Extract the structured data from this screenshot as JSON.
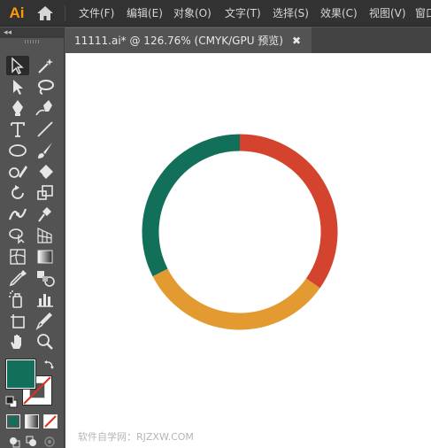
{
  "app": {
    "logo": "Ai",
    "home_icon": "home-icon"
  },
  "menu": {
    "items": [
      "文件(F)",
      "编辑(E)",
      "对象(O)",
      "文字(T)",
      "选择(S)",
      "效果(C)",
      "视图(V)",
      "窗口"
    ]
  },
  "document_tab": {
    "title": "11111.ai* @ 126.76% (CMYK/GPU 预览)",
    "close": "✖"
  },
  "toolbar": {
    "collapse": "◂◂",
    "tools": [
      "selection-tool",
      "magic-wand-tool",
      "direct-selection-tool",
      "lasso-tool",
      "pen-tool",
      "curvature-tool",
      "type-tool",
      "line-segment-tool",
      "ellipse-tool",
      "paintbrush-tool",
      "shaper-tool",
      "eraser-tool",
      "rotate-tool",
      "scale-tool",
      "width-tool",
      "puppet-warp-tool",
      "shape-builder-tool",
      "perspective-grid-tool",
      "mesh-tool",
      "gradient-tool",
      "eyedropper-tool",
      "blend-tool",
      "symbol-sprayer-tool",
      "column-graph-tool",
      "artboard-tool",
      "slice-tool",
      "hand-tool",
      "zoom-tool"
    ],
    "fill_color": "#12705a",
    "stroke_color": "none"
  },
  "canvas": {
    "ring_colors": {
      "red": "#d4432d",
      "orange": "#e29a31",
      "green": "#12705a"
    },
    "watermark": "软件自学网：RJZXW.COM"
  }
}
